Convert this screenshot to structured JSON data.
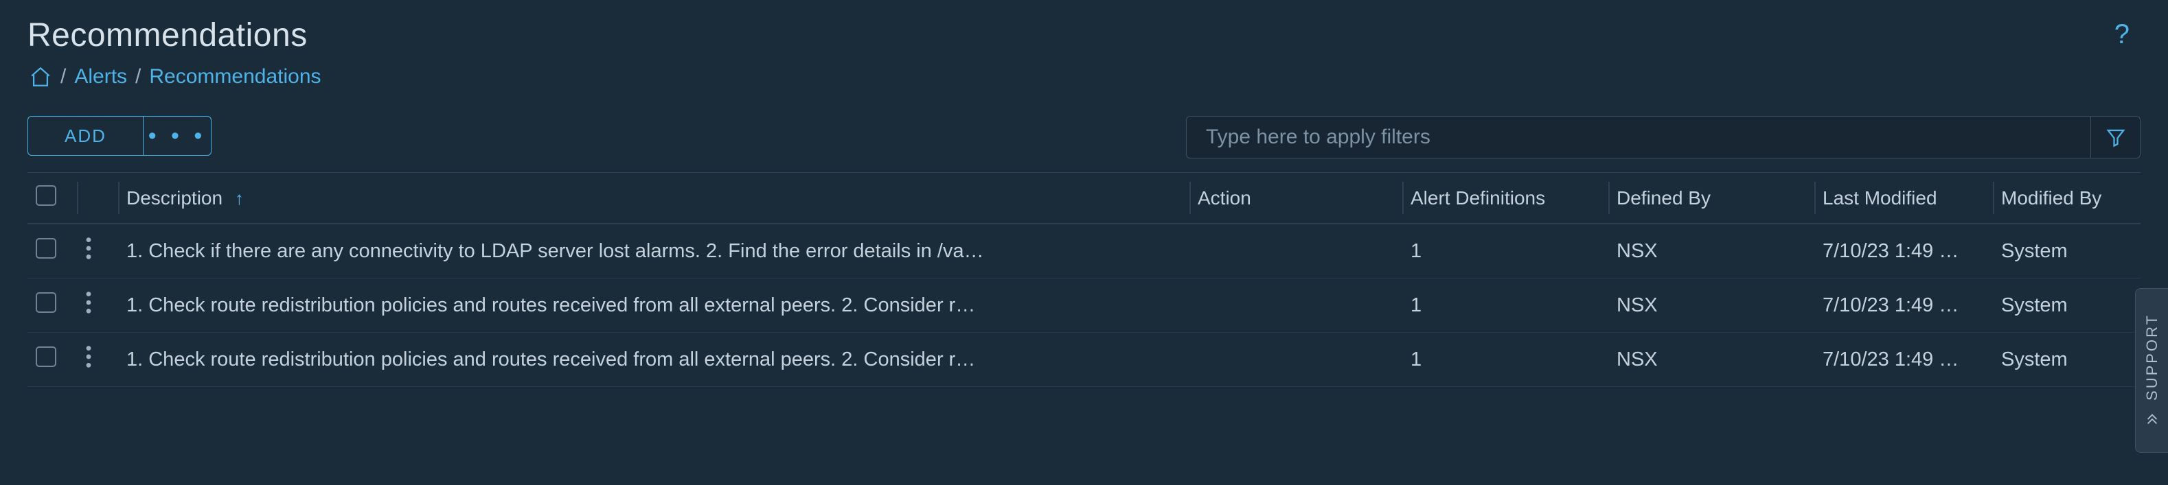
{
  "page": {
    "title": "Recommendations"
  },
  "breadcrumb": {
    "items": [
      "Alerts",
      "Recommendations"
    ]
  },
  "toolbar": {
    "add_label": "ADD",
    "more_label": "• • •"
  },
  "filter": {
    "placeholder": "Type here to apply filters",
    "value": ""
  },
  "columns": {
    "description": "Description",
    "action": "Action",
    "alert_definitions": "Alert Definitions",
    "defined_by": "Defined By",
    "last_modified": "Last Modified",
    "modified_by": "Modified By"
  },
  "sort": {
    "column": "description",
    "direction": "asc",
    "arrow": "↑"
  },
  "rows": [
    {
      "description": "1. Check if there are any connectivity to LDAP server lost alarms. 2. Find the error details in /va…",
      "action": "",
      "alert_definitions": "1",
      "defined_by": "NSX",
      "last_modified": "7/10/23 1:49 …",
      "modified_by": "System"
    },
    {
      "description": "1. Check route redistribution policies and routes received from all external peers. 2. Consider r…",
      "action": "",
      "alert_definitions": "1",
      "defined_by": "NSX",
      "last_modified": "7/10/23 1:49 …",
      "modified_by": "System"
    },
    {
      "description": "1. Check route redistribution policies and routes received from all external peers. 2. Consider r…",
      "action": "",
      "alert_definitions": "1",
      "defined_by": "NSX",
      "last_modified": "7/10/23 1:49 …",
      "modified_by": "System"
    }
  ],
  "support": {
    "label": "SUPPORT"
  }
}
